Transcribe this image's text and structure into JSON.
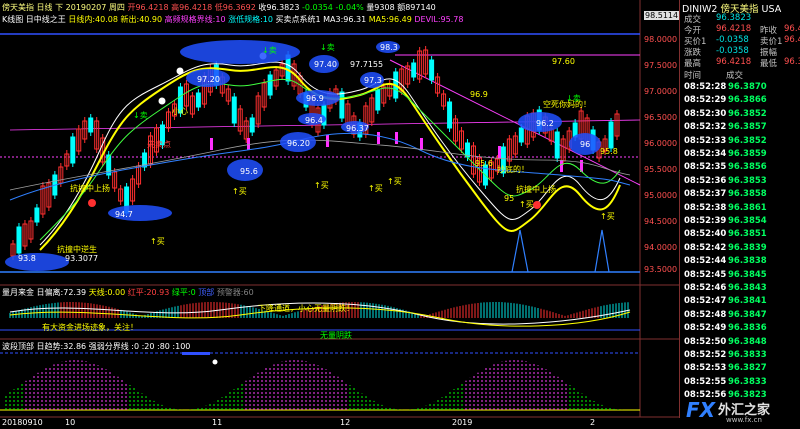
{
  "header": {
    "title": "傍天美指 日线 下",
    "date": "20190207",
    "weekday": "周四",
    "open": "开96.4218",
    "high": "高96.4218",
    "low": "低96.3692",
    "close": "收96.3823",
    "change": "-0.0354",
    "change_pct": "-0.04%",
    "volume": "量9308",
    "amount": "额897140"
  },
  "ind_line": {
    "name": "K线图",
    "f1": "日中线之王",
    "f2": "日线内:40.08",
    "f3": "新出:40.90",
    "f4": "高频规格界线:10",
    "f5": "涨低规格:10",
    "f6": "买卖点系统1",
    "ma3": "MA3:96.31",
    "ma5": "MA5:96.49",
    "devil": "DEVIL:95.78"
  },
  "right_axis": [
    "98.5114",
    "98.0000",
    "97.5000",
    "97.0000",
    "96.5000",
    "96.0000",
    "95.5000",
    "95.0000",
    "94.5000",
    "94.0000",
    "93.5000"
  ],
  "annotations": {
    "ell_93_8": "93.8",
    "ell_94_7": "94.7",
    "ell_95_6": "95.6",
    "ell_96_20": "96.20",
    "ell_96_4": "96.4",
    "ell_96_37": "96.37",
    "ell_96_9": "96.9",
    "ell_97_20": "97.20",
    "ell_97_40": "97.40",
    "ell_97_3": "97.3",
    "ell_98_3": "98.3",
    "ell_96_2": "96.2",
    "ell_96": "96",
    "lbl_97_7155": "97.7155",
    "lbl_97_60": "97.60",
    "lbl_96_9": "96.9",
    "lbl_95_6": "95.6",
    "lbl_95": "95",
    "lbl_95_8": "95.8",
    "lbl_93_3077": "93.3077",
    "up1": "↑买",
    "up2": "↑买",
    "up3": "↑买",
    "up4": "↑买",
    "up5": "↑买",
    "up6": "↑买",
    "up7": "↑买",
    "dn1": "↓卖",
    "dn2": "↓卖",
    "dn3": "↓卖",
    "dn4": "↓卖",
    "txt_kongjiao": "空死你妈的！",
    "txt_shangyang1": "抗撞中上扬",
    "txt_shangyang2": "抗撞中上扬",
    "txt_xianzhu": "先卖点",
    "txt_yunsheng": "抗撞中逆生",
    "txt_xiaoxin": "小心",
    "txt_wanye": "抄底的！"
  },
  "sub1": {
    "name": "量月来金",
    "a": "日偏离:72.39",
    "b": "天线:0.00",
    "c": "红平:20.93",
    "d": "绿平:0",
    "e": "顶部",
    "f": "预警器:60",
    "note1": "下降通道，小心无量阴跌！",
    "note2": "有大资金进场迹象，关注！",
    "note3": "无量阴跌"
  },
  "sub2": {
    "name": "波段顶部",
    "a": "日趋势:32.86",
    "b": "强弱分界线",
    "c": ":0",
    ":20": ":20",
    "d": ":20 :80 :100"
  },
  "xaxis": [
    "20180910",
    "10",
    "11",
    "12",
    "2019",
    "2"
  ],
  "quote": {
    "symbol": "DINIW2",
    "name": "傍天美指",
    "market": "USA",
    "rows": [
      {
        "l1": "成交",
        "v1": "96.3823",
        "l2": "",
        "v2": ""
      },
      {
        "l1": "今开",
        "v1": "96.4218",
        "l2": "昨收",
        "v2": "96.4"
      },
      {
        "l1": "买价1",
        "v1": "-0.0358",
        "l2": "卖价1",
        "v2": "96.4"
      },
      {
        "l1": "涨跌",
        "v1": "-0.0358",
        "l2": "振幅",
        "v2": ""
      },
      {
        "l1": "最高",
        "v1": "96.4218",
        "l2": "最低",
        "v2": "96.3"
      }
    ],
    "time_header": "时间",
    "price_header": "成交",
    "ticks": [
      {
        "t": "08:52:28",
        "p": "96.3870"
      },
      {
        "t": "08:52:29",
        "p": "96.3866"
      },
      {
        "t": "08:52:30",
        "p": "96.3852"
      },
      {
        "t": "08:52:32",
        "p": "96.3857"
      },
      {
        "t": "08:52:33",
        "p": "96.3852"
      },
      {
        "t": "08:52:34",
        "p": "96.3859"
      },
      {
        "t": "08:52:35",
        "p": "96.3856"
      },
      {
        "t": "08:52:36",
        "p": "96.3853"
      },
      {
        "t": "08:52:37",
        "p": "96.3858"
      },
      {
        "t": "08:52:38",
        "p": "96.3861"
      },
      {
        "t": "08:52:39",
        "p": "96.3854"
      },
      {
        "t": "08:52:40",
        "p": "96.3851"
      },
      {
        "t": "08:52:42",
        "p": "96.3839"
      },
      {
        "t": "08:52:44",
        "p": "96.3838"
      },
      {
        "t": "08:52:45",
        "p": "96.3845"
      },
      {
        "t": "08:52:46",
        "p": "96.3843"
      },
      {
        "t": "08:52:47",
        "p": "96.3841"
      },
      {
        "t": "08:52:48",
        "p": "96.3847"
      },
      {
        "t": "08:52:49",
        "p": "96.3836"
      },
      {
        "t": "08:52:50",
        "p": "96.3848"
      },
      {
        "t": "08:52:52",
        "p": "96.3833"
      },
      {
        "t": "08:52:53",
        "p": "96.3827"
      },
      {
        "t": "08:52:55",
        "p": "96.3833"
      },
      {
        "t": "08:52:56",
        "p": "96.3823"
      }
    ]
  },
  "watermark": {
    "text": "外汇之家",
    "sub": "www.fx.cn"
  },
  "colors": {
    "up": "#ff3030",
    "down": "#00ffff",
    "ellipse": "#2050ff",
    "yellow": "#ffff00",
    "magenta": "#ff30ff"
  }
}
